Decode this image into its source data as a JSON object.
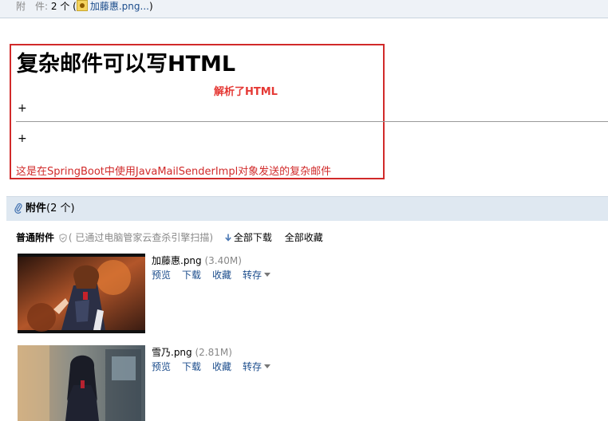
{
  "top_bar": {
    "label": "附　件:",
    "count": "2 个",
    "open_paren": "(",
    "first_file": "加藤惠.png...",
    "close_paren": ")"
  },
  "mail": {
    "title": "复杂邮件可以写HTML",
    "parsed_note": "解析了HTML",
    "plus_1": "+",
    "plus_2": "+",
    "body_text": "这是在SpringBoot中使用JavaMailSenderImpl对象发送的复杂邮件"
  },
  "attachments": {
    "header_label": "附件",
    "header_count": "(2 个)",
    "section_label": "普通附件",
    "scan_note": "( 已通过电脑管家云查杀引擎扫描)",
    "download_all": "全部下载",
    "save_all": "全部收藏",
    "files": [
      {
        "name": "加藤惠.png",
        "size": "(3.40M)",
        "actions": [
          "预览",
          "下载",
          "收藏",
          "转存"
        ]
      },
      {
        "name": "雪乃.png",
        "size": "(2.81M)",
        "actions": [
          "预览",
          "下载",
          "收藏",
          "转存"
        ]
      }
    ]
  },
  "colors": {
    "accent_red": "#d12a2a",
    "note_red": "#e53935",
    "link_blue": "#1c4d8c",
    "header_bg": "#dfe8f1"
  }
}
